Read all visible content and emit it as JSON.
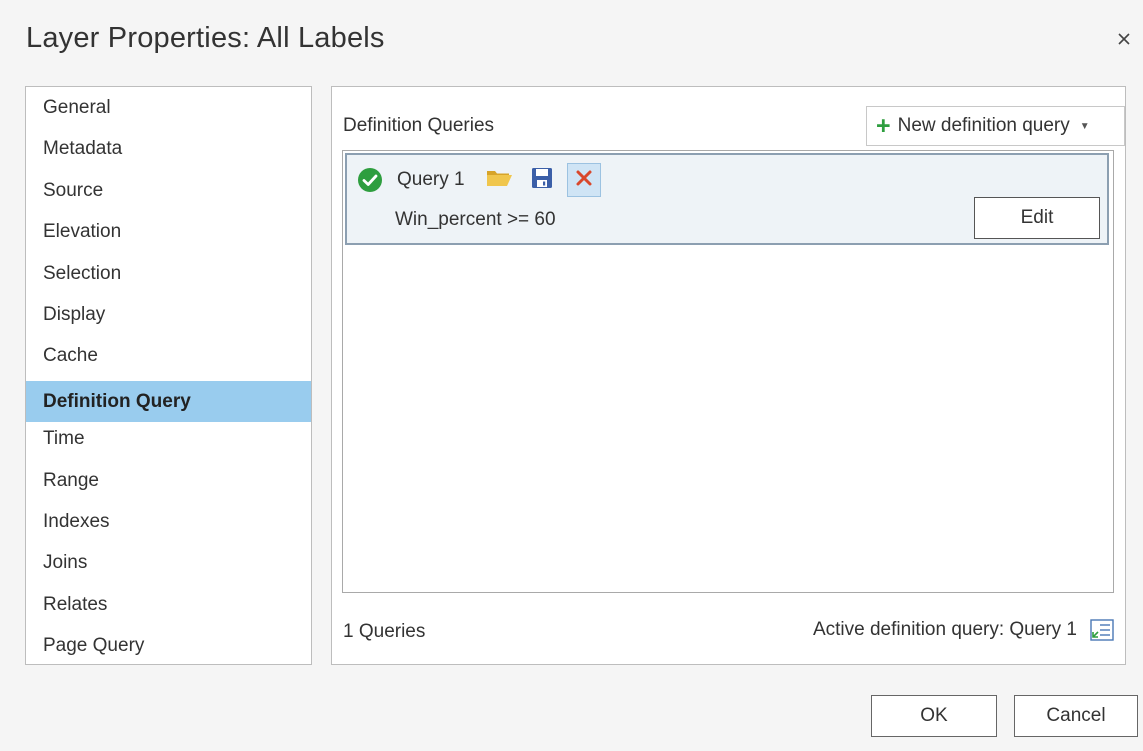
{
  "window": {
    "title": "Layer Properties: All Labels",
    "close_icon": "close-icon"
  },
  "sidebar": {
    "items": [
      {
        "label": "General",
        "active": false
      },
      {
        "label": "Metadata",
        "active": false
      },
      {
        "label": "Source",
        "active": false
      },
      {
        "label": "Elevation",
        "active": false
      },
      {
        "label": "Selection",
        "active": false
      },
      {
        "label": "Display",
        "active": false
      },
      {
        "label": "Cache",
        "active": false
      },
      {
        "label": "Definition Query",
        "active": true
      },
      {
        "label": "Time",
        "active": false
      },
      {
        "label": "Range",
        "active": false
      },
      {
        "label": "Indexes",
        "active": false
      },
      {
        "label": "Joins",
        "active": false
      },
      {
        "label": "Relates",
        "active": false
      },
      {
        "label": "Page Query",
        "active": false
      }
    ],
    "active_color": "#99ccee"
  },
  "main": {
    "section_title": "Definition Queries",
    "new_query_button": {
      "label": "New definition query",
      "icon": "plus-icon",
      "dropdown_icon": "caret-down-icon"
    },
    "queries": [
      {
        "name": "Query 1",
        "status_icon": "check-circle-icon",
        "expression": "Win_percent >= 60",
        "edit_label": "Edit",
        "actions": [
          "folder-open-icon",
          "save-icon",
          "delete-icon"
        ]
      }
    ],
    "footer": {
      "count_text": "1 Queries",
      "active_text": "Active definition query: Query 1",
      "active_icon": "list-icon"
    }
  },
  "buttons": {
    "ok": "OK",
    "cancel": "Cancel"
  },
  "colors": {
    "accent_green": "#2e9e3f",
    "delete_red": "#d9472b",
    "folder_yellow": "#e8b83a",
    "save_blue": "#3b5fa8"
  }
}
